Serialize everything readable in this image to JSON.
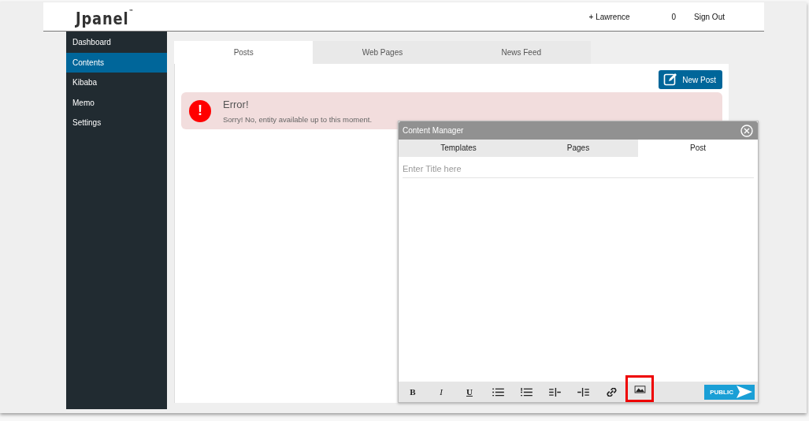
{
  "header": {
    "logo": "Jpanel",
    "trademark": "™",
    "user": "+ Lawrence",
    "count": "0",
    "sign_out": "Sign Out"
  },
  "sidebar": {
    "items": [
      {
        "label": "Dashboard",
        "selected": false
      },
      {
        "label": "Contents",
        "selected": true
      },
      {
        "label": "Kibaba",
        "selected": false
      },
      {
        "label": "Memo",
        "selected": false
      },
      {
        "label": "Settings",
        "selected": false
      }
    ]
  },
  "tabs": [
    {
      "label": "Posts",
      "selected": true
    },
    {
      "label": "Web Pages",
      "selected": false
    },
    {
      "label": "News Feed",
      "selected": false
    }
  ],
  "new_post_button": "New Post",
  "alert": {
    "title": "Error!",
    "message": "Sorry! No, entity available up to this moment.",
    "icon": "!"
  },
  "modal": {
    "title": "Content Manager",
    "tabs": [
      {
        "label": "Templates",
        "selected": false
      },
      {
        "label": "Pages",
        "selected": false
      },
      {
        "label": "Post",
        "selected": true
      }
    ],
    "title_field": {
      "placeholder": "Enter Title here"
    },
    "toolbar": [
      {
        "kind": "bold",
        "label": "B",
        "highlighted": false
      },
      {
        "kind": "italic",
        "label": "I",
        "highlighted": false
      },
      {
        "kind": "underline",
        "label": "U",
        "highlighted": false
      },
      {
        "kind": "bullets",
        "highlighted": false
      },
      {
        "kind": "numbers",
        "highlighted": false
      },
      {
        "kind": "indent",
        "highlighted": false
      },
      {
        "kind": "outdent",
        "highlighted": false
      },
      {
        "kind": "link",
        "highlighted": false
      },
      {
        "kind": "image",
        "highlighted": true
      }
    ],
    "publish_button": "PUBLIC"
  }
}
